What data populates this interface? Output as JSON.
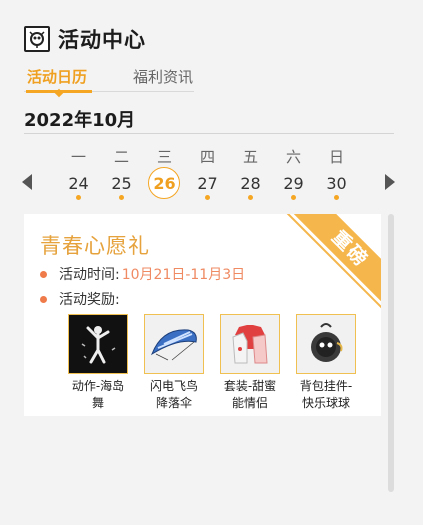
{
  "header": {
    "title": "活动中心",
    "icon": "activity-center-icon"
  },
  "tabs": [
    {
      "label": "活动日历",
      "active": true
    },
    {
      "label": "福利资讯",
      "active": false
    }
  ],
  "calendar": {
    "month": "2022年10月",
    "weekdays": [
      "一",
      "二",
      "三",
      "四",
      "五",
      "六",
      "日"
    ],
    "dates": [
      "24",
      "25",
      "26",
      "27",
      "28",
      "29",
      "30"
    ],
    "selected": "26"
  },
  "event": {
    "title": "青春心愿礼",
    "badge": "重磅",
    "time_label": "活动时间:",
    "time_value": "10月21日-11月3日",
    "reward_label": "活动奖励:",
    "rewards": [
      {
        "name": "动作-海岛舞",
        "icon": "dance-emote-icon"
      },
      {
        "name": "闪电飞鸟降落伞",
        "icon": "parachute-icon"
      },
      {
        "name": "套装-甜蜜能情侣",
        "icon": "outfit-icon"
      },
      {
        "name": "背包挂件-快乐球球",
        "icon": "backpack-charm-icon"
      }
    ]
  },
  "colors": {
    "accent": "#f5a623",
    "title": "#e6a23c",
    "bullet": "#ef7a4a",
    "badge": "#f5b64b"
  }
}
